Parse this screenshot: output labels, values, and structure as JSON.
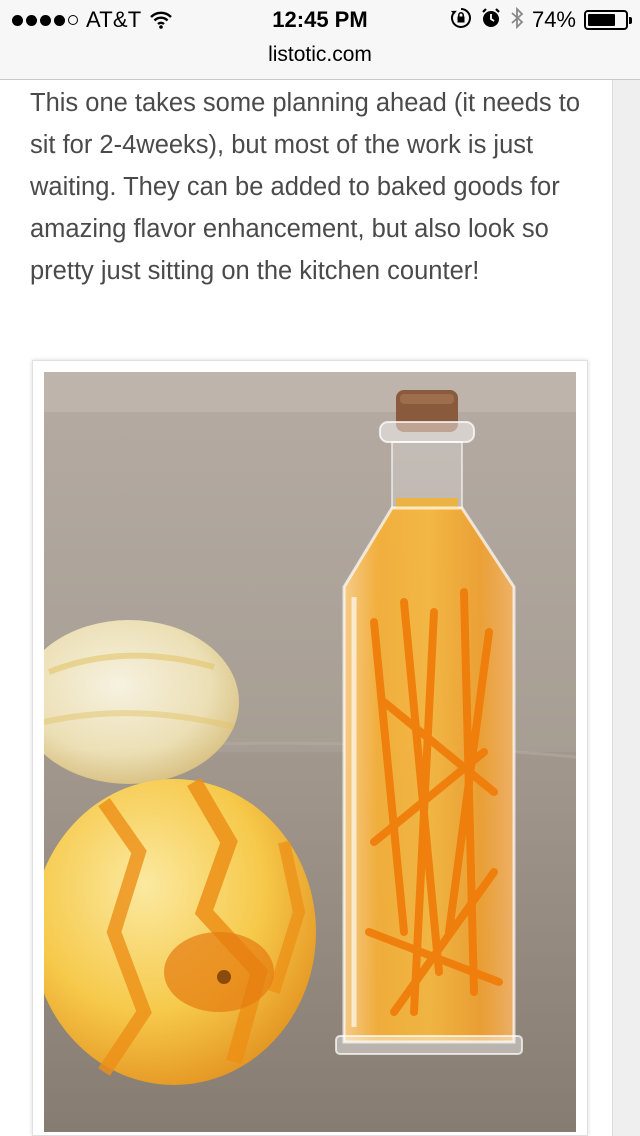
{
  "status_bar": {
    "carrier": "AT&T",
    "time": "12:45 PM",
    "battery_percent": "74%",
    "battery_level": 0.74,
    "signal_dots_filled": 4,
    "signal_dots_total": 5,
    "icons": [
      "wifi-icon",
      "rotation-lock-icon",
      "alarm-icon",
      "bluetooth-icon",
      "battery-icon"
    ]
  },
  "browser": {
    "url": "listotic.com"
  },
  "article": {
    "paragraph": "This one takes some planning ahead (it needs to sit for 2-4weeks), but most of the work is just waiting. They can be added to baked goods for amazing flavor enhancement, but also look so pretty just sitting on the kitchen counter!"
  },
  "colors": {
    "text": "#4a4a4a",
    "background": "#ffffff",
    "chrome": "#f7f7f7",
    "orange": "#f08a10"
  }
}
